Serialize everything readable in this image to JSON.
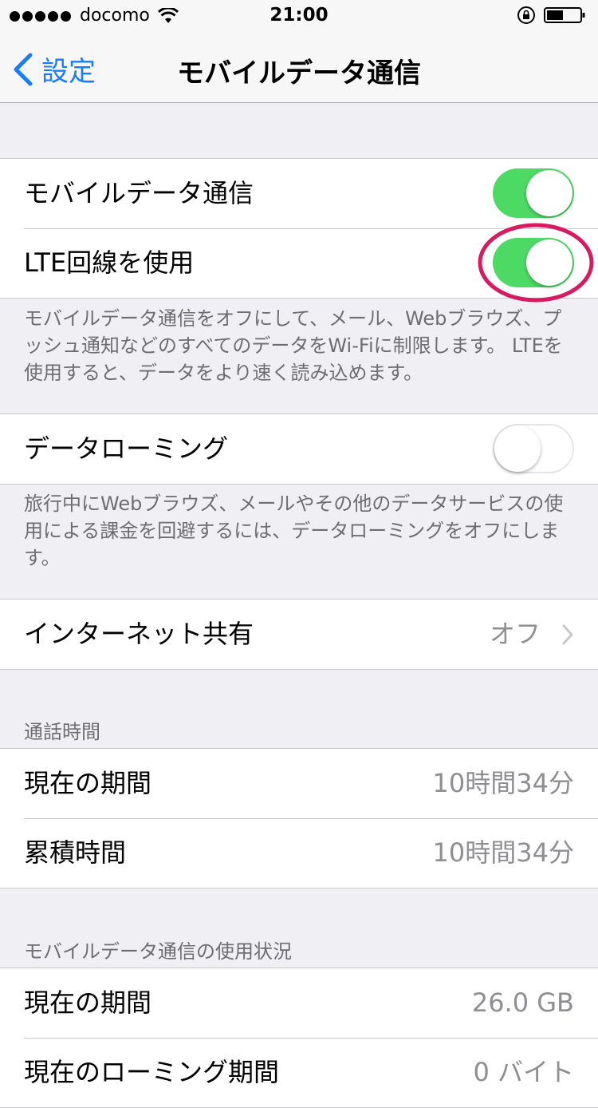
{
  "status_bar": {
    "carrier": "docomo",
    "time": "21:00",
    "signal_dots": 5
  },
  "nav": {
    "back_label": "設定",
    "title": "モバイルデータ通信"
  },
  "group1": {
    "rows": [
      {
        "label": "モバイルデータ通信",
        "toggle": true
      },
      {
        "label": "LTE回線を使用",
        "toggle": true
      }
    ],
    "footer": "モバイルデータ通信をオフにして、メール、Webブラウズ、プッシュ通知などのすべてのデータをWi-Fiに制限します。 LTEを使用すると、データをより速く読み込めます。"
  },
  "group2": {
    "rows": [
      {
        "label": "データローミング",
        "toggle": false
      }
    ],
    "footer": "旅行中にWebブラウズ、メールやその他のデータサービスの使用による課金を回避するには、データローミングをオフにします。"
  },
  "group3": {
    "rows": [
      {
        "label": "インターネット共有",
        "value": "オフ"
      }
    ]
  },
  "call_time": {
    "header": "通話時間",
    "rows": [
      {
        "label": "現在の期間",
        "value": "10時間34分"
      },
      {
        "label": "累積時間",
        "value": "10時間34分"
      }
    ]
  },
  "data_usage": {
    "header": "モバイルデータ通信の使用状況",
    "rows": [
      {
        "label": "現在の期間",
        "value": "26.0 GB"
      },
      {
        "label": "現在のローミング期間",
        "value": "0 バイト"
      }
    ]
  },
  "colors": {
    "accent": "#1a7cf8",
    "toggle_on": "#4cd964",
    "highlight": "#d81b60",
    "background": "#efeff4"
  }
}
